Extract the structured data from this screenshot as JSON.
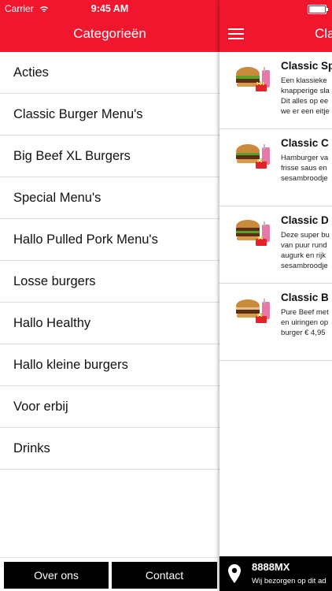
{
  "status_bar": {
    "carrier": "Carrier",
    "time": "9:45 AM",
    "battery_level": 1.0
  },
  "categories_panel": {
    "title": "Categorieën",
    "items": [
      {
        "label": "Acties"
      },
      {
        "label": "Classic Burger Menu's"
      },
      {
        "label": "Big Beef XL Burgers"
      },
      {
        "label": "Special Menu's"
      },
      {
        "label": "Hallo Pulled Pork Menu's"
      },
      {
        "label": "Losse burgers"
      },
      {
        "label": "Hallo Healthy"
      },
      {
        "label": "Hallo kleine burgers"
      },
      {
        "label": "Voor erbij"
      },
      {
        "label": "Drinks"
      }
    ],
    "footer": {
      "about_label": "Over ons",
      "contact_label": "Contact"
    }
  },
  "content_panel": {
    "title": "Cla",
    "menu_items": [
      {
        "name": "Classic Sp",
        "description": "Een klassieke\nknapperige sla\nDit alles op ee\nwe er een eitje"
      },
      {
        "name": "Classic C",
        "description": "Hamburger va\nfrisse saus en\nsesambroodje"
      },
      {
        "name": "Classic D",
        "description": "Deze super bu\nvan puur rund\naugurk en rijk\nsesambroodje"
      },
      {
        "name": "Classic B",
        "description": "Pure Beef met\nen uiringen op\nburger € 4,95"
      }
    ],
    "delivery": {
      "postcode": "8888MX",
      "message": "Wij bezorgen op dit ad"
    }
  },
  "colors": {
    "brand_red": "#f0162d",
    "footer_black": "#000000"
  },
  "icons": {
    "wifi": "wifi-icon",
    "menu": "hamburger-menu-icon",
    "location": "location-pin-icon",
    "battery": "battery-icon"
  }
}
